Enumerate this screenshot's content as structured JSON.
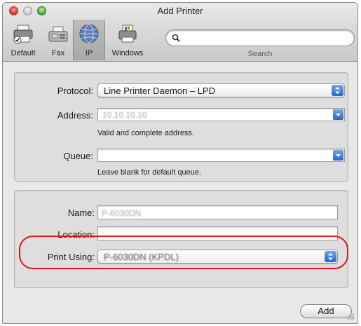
{
  "window": {
    "title": "Add Printer"
  },
  "toolbar": {
    "items": [
      {
        "label": "Default",
        "icon": "default-printer-icon"
      },
      {
        "label": "Fax",
        "icon": "fax-icon"
      },
      {
        "label": "IP",
        "icon": "ip-globe-icon",
        "selected": true
      },
      {
        "label": "Windows",
        "icon": "windows-printer-icon"
      }
    ],
    "search": {
      "label": "Search",
      "value": "",
      "placeholder": ""
    }
  },
  "connection": {
    "protocol": {
      "label": "Protocol:",
      "value": "Line Printer Daemon – LPD"
    },
    "address": {
      "label": "Address:",
      "value": "10.10.10.10",
      "hint": "Valid and complete address."
    },
    "queue": {
      "label": "Queue:",
      "value": "",
      "hint": "Leave blank for default queue."
    }
  },
  "printer": {
    "name": {
      "label": "Name:",
      "value": "P-6030DN"
    },
    "location": {
      "label": "Location:",
      "value": ""
    },
    "print_using": {
      "label": "Print Using:",
      "value": "P-6030DN (KPDL)"
    }
  },
  "actions": {
    "add_label": "Add"
  },
  "colors": {
    "accent_blue": "#2a68c8",
    "highlight_red": "#e0141e"
  }
}
